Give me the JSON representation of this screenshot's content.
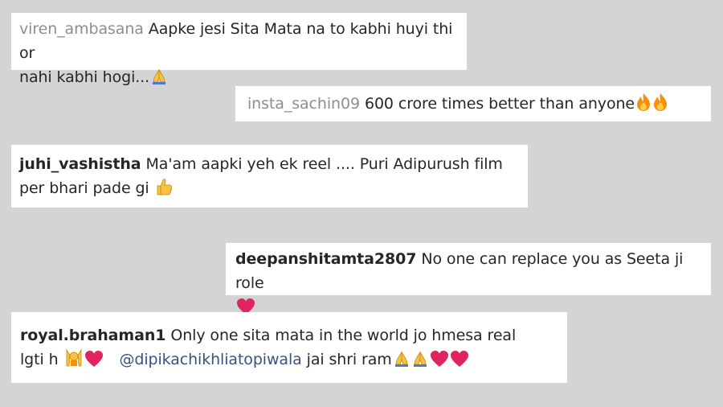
{
  "comments": [
    {
      "username": "viren_ambasana",
      "text_lines": [
        "Aapke jesi Sita Mata na to kabhi huyi thi or",
        "nahi kabhi hogi..."
      ],
      "emojis": [
        "folded-hands"
      ]
    },
    {
      "username": "insta_sachin09",
      "text": "600 crore times better than anyone",
      "emojis": [
        "fire",
        "fire"
      ]
    },
    {
      "username": "juhi_vashistha",
      "text_lines": [
        "Ma'am aapki yeh ek reel .... Puri Adipurush film",
        "per bhari pade gi "
      ],
      "emojis": [
        "thumbs-up"
      ]
    },
    {
      "username": "deepanshitamta2807",
      "text": "No one can replace you as Seeta ji role",
      "emojis": [
        "red-heart"
      ]
    },
    {
      "username": "royal.brahaman1",
      "text_lines": [
        "Only one sita mata in the world jo hmesa real",
        "lgti h "
      ],
      "mention": "@dipikachikhliatopiwala",
      "tail_text": "jai shri ram",
      "emojis": [
        "person-raising-hands",
        "red-heart",
        "folded-hands",
        "folded-hands",
        "red-heart",
        "red-heart"
      ]
    }
  ],
  "colors": {
    "background": "#d4d4d6",
    "card": "#ffffff",
    "username": "#262626",
    "faded_username": "#8e8e8e",
    "mention": "#385185",
    "heart": "#e0245e",
    "fire": "#f4900c"
  }
}
